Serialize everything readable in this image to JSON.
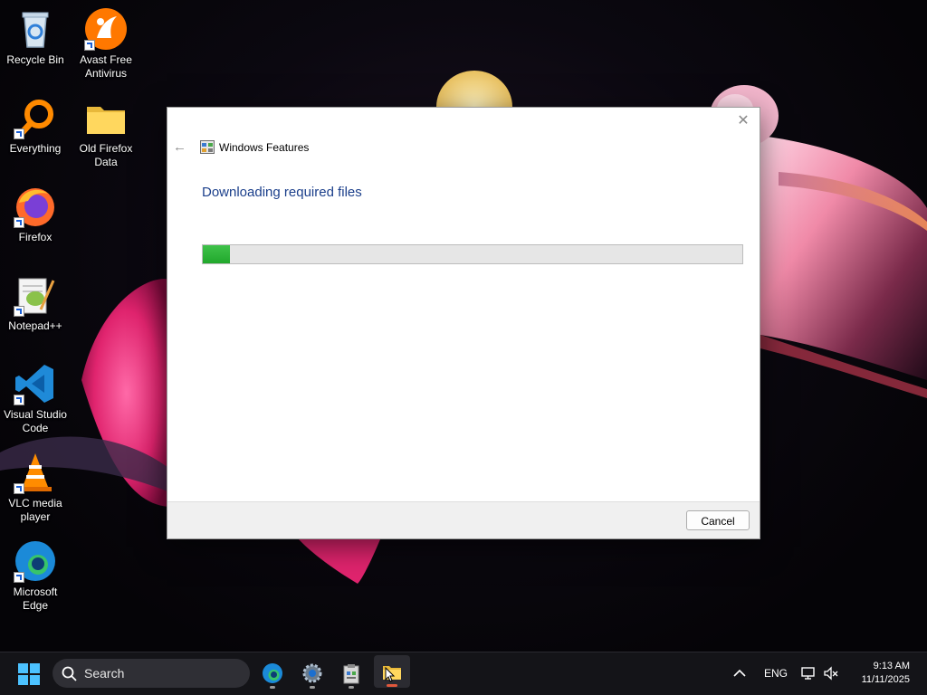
{
  "desktop": {
    "icons": [
      {
        "label": "Recycle Bin",
        "icon": "recycle-bin-icon"
      },
      {
        "label": "Avast Free Antivirus",
        "icon": "avast-icon"
      },
      {
        "label": "Everything",
        "icon": "everything-search-icon"
      },
      {
        "label": "Old Firefox Data",
        "icon": "folder-icon"
      },
      {
        "label": "Firefox",
        "icon": "firefox-icon"
      },
      {
        "label": "Notepad++",
        "icon": "notepadpp-icon"
      },
      {
        "label": "Visual Studio Code",
        "icon": "vscode-icon"
      },
      {
        "label": "VLC media player",
        "icon": "vlc-icon"
      },
      {
        "label": "Microsoft Edge",
        "icon": "edge-icon"
      }
    ]
  },
  "dialog": {
    "close_glyph": "✕",
    "back_glyph": "←",
    "title": "Windows Features",
    "heading": "Downloading required files",
    "progress": 0.05,
    "cancel_label": "Cancel"
  },
  "taskbar": {
    "search_label": "Search",
    "items": [
      "edge-icon",
      "settings-icon",
      "clipboard-app-icon",
      "file-explorer-icon"
    ],
    "active_item": "file-explorer-icon",
    "tray": {
      "language": "ENG",
      "time": "9:13 AM",
      "date": "11/11/2025"
    }
  },
  "colors": {
    "heading": "#1b3f8b",
    "progress_fill": "#21a82c",
    "taskbar": "#141418"
  }
}
